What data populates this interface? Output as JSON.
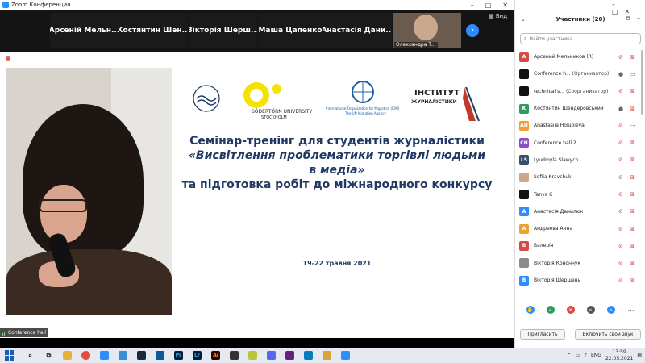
{
  "window": {
    "title": "Zoom Конференция"
  },
  "stripe": {
    "tiles": [
      "Арсеній Мельн...",
      "Костянтин Шен...",
      "Вікторія Шерш...",
      "Маша Цапенко",
      "Анастасія Дани..."
    ],
    "self_label": "Олександра Т...",
    "view_label": "Вид"
  },
  "speaker": {
    "name_label": "Conference hall"
  },
  "slide": {
    "logos": [
      "COUNCIL OF THE BALTIC SEA STATES",
      "SÖDERTÖRN UNIVERSITY",
      "STOCKHOLM",
      "International Organization for Migration (IOM)",
      "The UN Migration Agency",
      "ІНСТИТУТ",
      "ЖУРНАЛІСТИКИ"
    ],
    "title_line1": "Семінар-тренінг для студентів журналістики",
    "title_line2": "«Висвітлення проблематики торгівлі людьми",
    "title_line3": "в медіа»",
    "title_line4": "та підготовка робіт до міжнародного конкурсу",
    "date": "19-22 травня 2021"
  },
  "panel": {
    "title": "Участники (20)",
    "search_placeholder": "Найти участника",
    "participants": [
      {
        "initials": "A",
        "color": "#d64b44",
        "name": "Арсений Мельников (R)",
        "role": "",
        "mic": "muted",
        "video": "off"
      },
      {
        "initials": "",
        "color": "#111111",
        "name": "Conference h...",
        "role": "(Организатор)",
        "mic": "on",
        "video": "on"
      },
      {
        "initials": "",
        "color": "#111111",
        "name": "technical s...",
        "role": "(Соорганизатор)",
        "mic": "muted",
        "video": "off"
      },
      {
        "initials": "K",
        "color": "#2e9c5b",
        "name": "Костянтин Шендеровський",
        "role": "",
        "mic": "on",
        "video": "off"
      },
      {
        "initials": "AH",
        "color": "#f0a030",
        "name": "Anastasiia Holubieva",
        "role": "",
        "mic": "muted",
        "video": "on"
      },
      {
        "initials": "CH",
        "color": "#8a4fc6",
        "name": "Conference hall 2",
        "role": "",
        "mic": "muted",
        "video": "off"
      },
      {
        "initials": "LS",
        "color": "#3a5068",
        "name": "Lyudmyla Slawych",
        "role": "",
        "mic": "muted",
        "video": "off"
      },
      {
        "initials": "",
        "color": "#c9a88e",
        "name": "Sofiia Kravchuk",
        "role": "",
        "mic": "muted",
        "video": "off"
      },
      {
        "initials": "",
        "color": "#111111",
        "name": "Tanya K",
        "role": "",
        "mic": "muted",
        "video": "off"
      },
      {
        "initials": "A",
        "color": "#2d8cff",
        "name": "Анастасія Данилюк",
        "role": "",
        "mic": "muted",
        "video": "off"
      },
      {
        "initials": "A",
        "color": "#f0a030",
        "name": "Андреева Анна",
        "role": "",
        "mic": "muted",
        "video": "off"
      },
      {
        "initials": "B",
        "color": "#d64b44",
        "name": "Валерія",
        "role": "",
        "mic": "muted",
        "video": "off"
      },
      {
        "initials": "",
        "color": "#8a8a8a",
        "name": "Вікторія Кононнук",
        "role": "",
        "mic": "muted",
        "video": "off"
      },
      {
        "initials": "B",
        "color": "#2d8cff",
        "name": "Вікторія Шершень",
        "role": "",
        "mic": "muted",
        "video": "off"
      }
    ],
    "invite_label": "Пригласить",
    "unmute_label": "Включить свой звук"
  },
  "taskbar": {
    "lang": "ENG",
    "time": "13:59",
    "date": "22.05.2021",
    "apps": [
      "Ps",
      "Lr",
      "Ai"
    ]
  },
  "colors": {
    "accent": "#2d8cff",
    "muted": "#d64b44",
    "slide_text": "#1f3864"
  }
}
